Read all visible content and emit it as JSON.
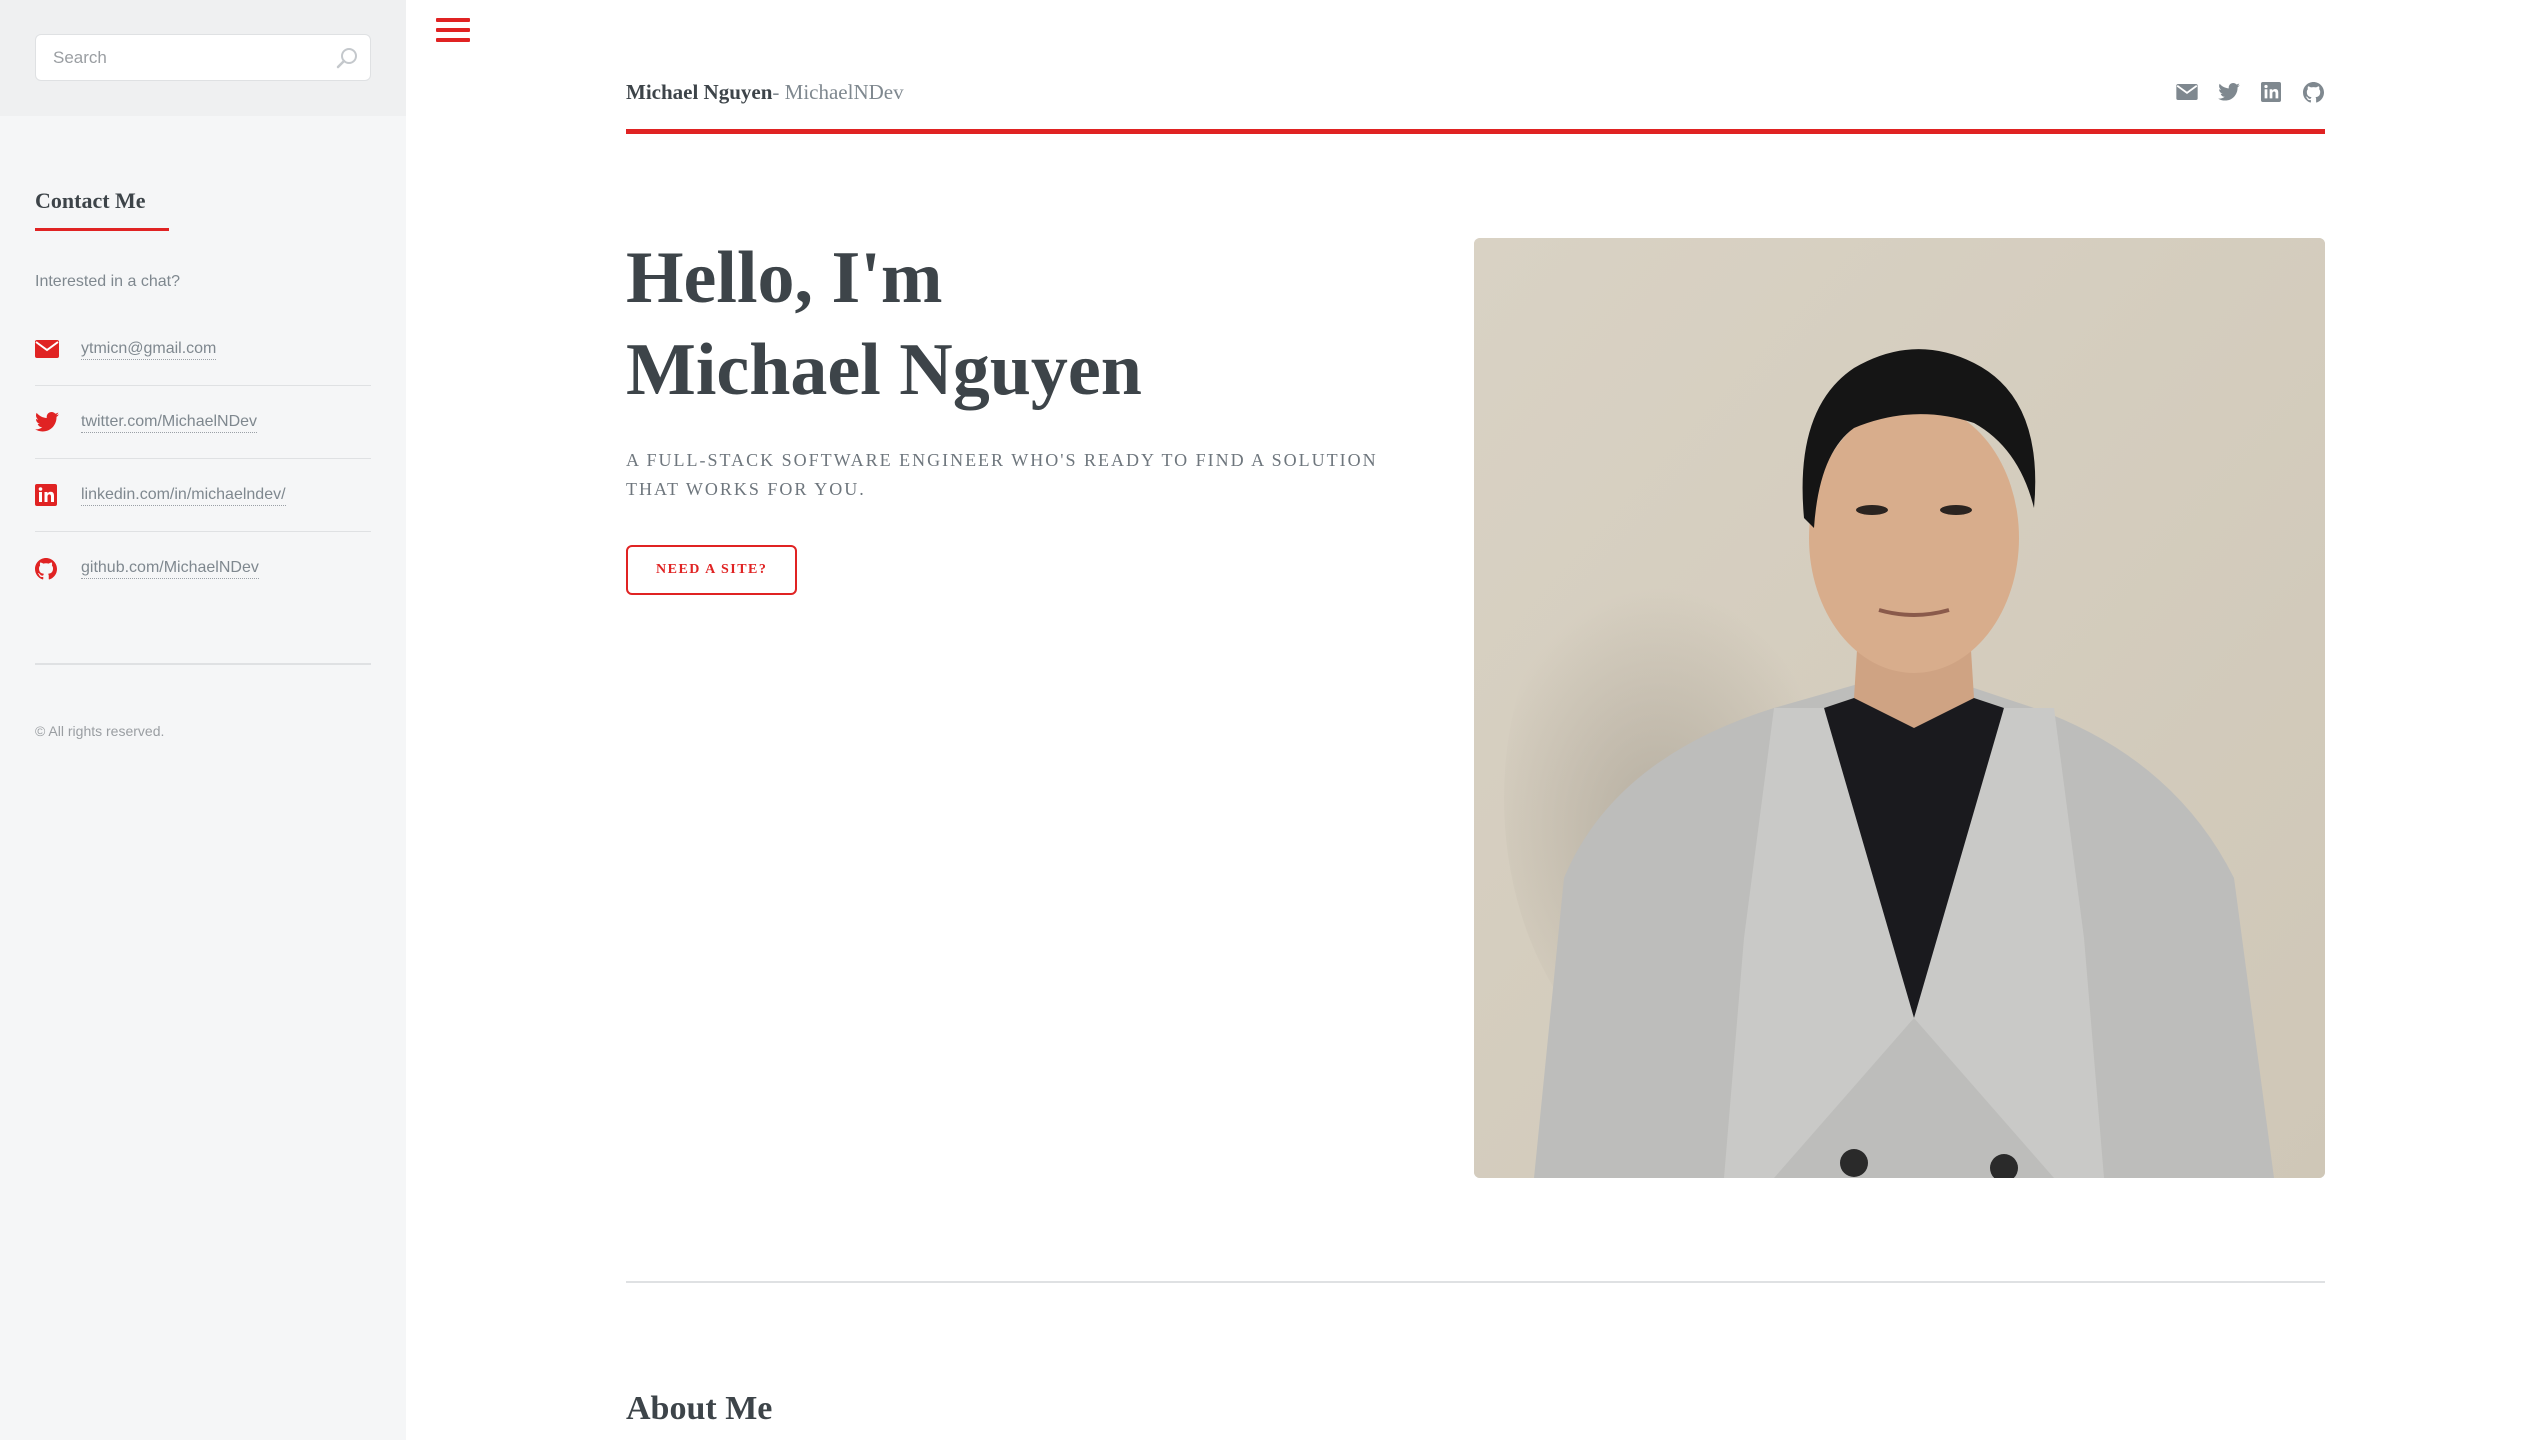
{
  "sidebar": {
    "search": {
      "placeholder": "Search"
    },
    "contact": {
      "title": "Contact Me",
      "intro": "Interested in a chat?",
      "items": [
        {
          "icon": "envelope-icon",
          "label": "ytmicn@gmail.com"
        },
        {
          "icon": "twitter-icon",
          "label": "twitter.com/MichaelNDev"
        },
        {
          "icon": "linkedin-icon",
          "label": "linkedin.com/in/michaelndev/"
        },
        {
          "icon": "github-icon",
          "label": "github.com/MichaelNDev"
        }
      ]
    },
    "copyright": "© All rights reserved."
  },
  "header": {
    "brand_name": "Michael Nguyen",
    "brand_sub": "- MichaelNDev",
    "icons": [
      "envelope-icon",
      "twitter-icon",
      "linkedin-icon",
      "github-icon"
    ]
  },
  "hero": {
    "title_line1": "Hello, I'm",
    "title_line2": "Michael Nguyen",
    "subtitle": "A full-stack software engineer who's ready to find a solution that works for you.",
    "cta_label": "Need a site?"
  },
  "about": {
    "title": "About Me"
  },
  "colors": {
    "accent": "#e02323",
    "text": "#3d4449",
    "muted": "#7f888f",
    "sidebar_bg": "#f5f6f7"
  }
}
